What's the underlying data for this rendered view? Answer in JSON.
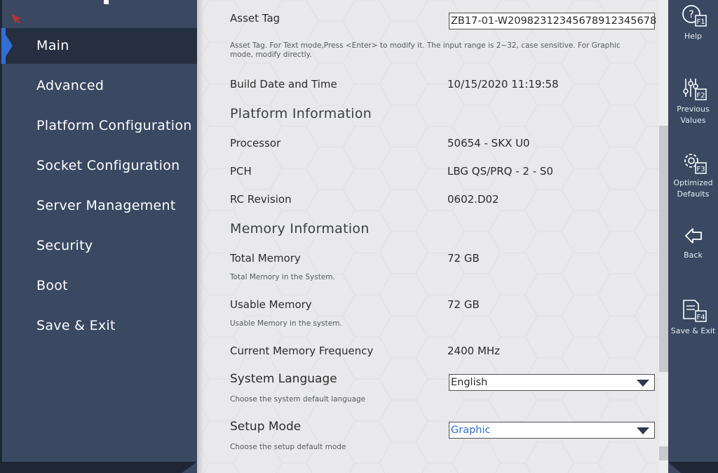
{
  "sidebar": {
    "items": [
      {
        "label": "Main"
      },
      {
        "label": "Advanced"
      },
      {
        "label": "Platform Configuration"
      },
      {
        "label": "Socket Configuration"
      },
      {
        "label": "Server Management"
      },
      {
        "label": "Security"
      },
      {
        "label": "Boot"
      },
      {
        "label": "Save & Exit"
      }
    ],
    "active_index": 0,
    "icons": {
      "logo": "cursor-logo-icon"
    }
  },
  "main": {
    "asset_tag": {
      "label": "Asset Tag",
      "value": "ZB17-01-W2098231234567891234567​8",
      "help": "Asset Tag. For Text mode,Press <Enter> to modify it. The input range is 2~32, case sensitive. For Graphic mode, modify directly."
    },
    "build": {
      "label": "Build Date and Time",
      "value": "10/15/2020 11:19:58"
    },
    "platform_section": "Platform Information",
    "processor": {
      "label": "Processor",
      "value": "50654 - SKX U0"
    },
    "pch": {
      "label": "PCH",
      "value": "LBG QS/PRQ - 2 - S0"
    },
    "rc_revision": {
      "label": "RC Revision",
      "value": "0602.D02"
    },
    "memory_section": "Memory Information",
    "total_memory": {
      "label": "Total Memory",
      "value": "72 GB",
      "help": "Total Memory in the System."
    },
    "usable_memory": {
      "label": "Usable Memory",
      "value": "72 GB",
      "help": "Usable Memory in the system."
    },
    "mem_freq": {
      "label": "Current Memory Frequency",
      "value": "2400 MHz"
    },
    "system_language": {
      "label": "System Language",
      "value": "English",
      "help": "Choose the system default language"
    },
    "setup_mode": {
      "label": "Setup Mode",
      "value": "Graphic",
      "help": "Choose the setup default mode"
    }
  },
  "hotkeys": [
    {
      "key": "F1",
      "label": "Help",
      "icon": "help-icon"
    },
    {
      "key": "F2",
      "label": "Previous Values",
      "icon": "sliders-icon"
    },
    {
      "key": "F3",
      "label": "Optimized Defaults",
      "icon": "gear-icon"
    },
    {
      "key": "",
      "label": "Back",
      "icon": "back-arrow-icon"
    },
    {
      "key": "F4",
      "label": "Save & Exit",
      "icon": "save-icon"
    }
  ],
  "colors": {
    "accent": "#2f6fd6",
    "sidebar": "#3a4862",
    "panel": "#e9e9eb"
  }
}
